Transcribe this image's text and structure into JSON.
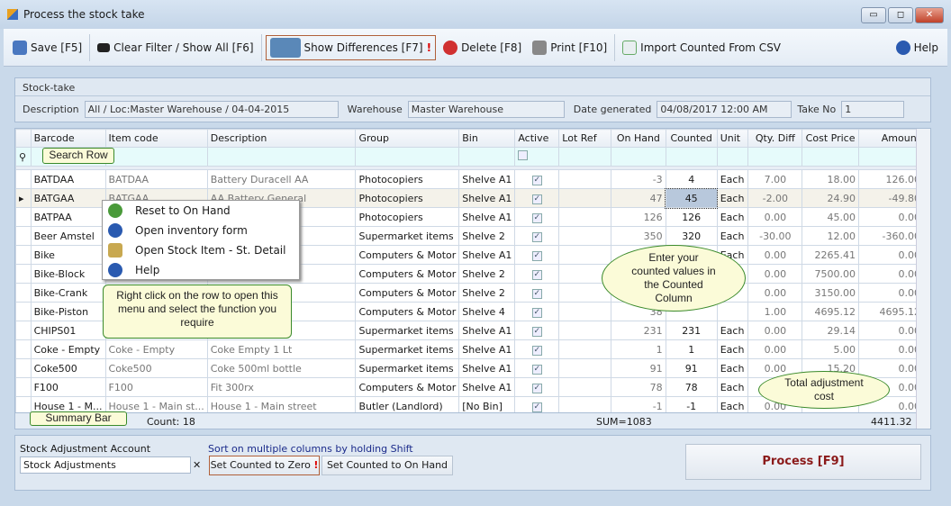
{
  "window": {
    "title": "Process the stock take",
    "minimize": "▭",
    "maximize": "◻",
    "close": "✕"
  },
  "toolbar": {
    "save": "Save [F5]",
    "clear": "Clear Filter / Show All [F6]",
    "diff": "Show Differences [F7]",
    "diff_mark": "!",
    "delete": "Delete [F8]",
    "print": "Print [F10]",
    "import": "Import Counted From CSV",
    "help": "Help"
  },
  "stocktake": {
    "header": "Stock-take",
    "desc_label": "Description",
    "desc": "All / Loc:Master Warehouse / 04-04-2015",
    "wh_label": "Warehouse",
    "wh": "Master Warehouse",
    "date_label": "Date generated",
    "date": "04/08/2017 12:00 AM",
    "take_label": "Take No",
    "take": "1"
  },
  "grid": {
    "columns": [
      "Barcode",
      "Item code",
      "Description",
      "Group",
      "Bin",
      "Active",
      "Lot Ref",
      "On Hand",
      "Counted",
      "Unit",
      "Qty. Diff",
      "Cost Price",
      "Amount"
    ],
    "rows": [
      [
        "BATDAA",
        "BATDAA",
        "Battery Duracell AA",
        "Photocopiers",
        "Shelve A1",
        "✓",
        "",
        "-3",
        "4",
        "Each",
        "7.00",
        "18.00",
        "126.00"
      ],
      [
        "BATGAA",
        "BATGAA",
        "AA Battery General",
        "Photocopiers",
        "Shelve A1",
        "✓",
        "",
        "47",
        "45",
        "Each",
        "-2.00",
        "24.90",
        "-49.80"
      ],
      [
        "BATPAA",
        "",
        "egression)",
        "Photocopiers",
        "Shelve A1",
        "✓",
        "",
        "126",
        "126",
        "Each",
        "0.00",
        "45.00",
        "0.00"
      ],
      [
        "Beer Amstel",
        "",
        "",
        "Supermarket items",
        "Shelve 2",
        "✓",
        "",
        "350",
        "320",
        "Each",
        "-30.00",
        "12.00",
        "-360.00"
      ],
      [
        "Bike",
        "",
        "",
        "Computers & Motor",
        "Shelve A1",
        "✓",
        "",
        "3",
        "",
        "Each",
        "0.00",
        "2265.41",
        "0.00"
      ],
      [
        "Bike-Block",
        "",
        "",
        "Computers & Motor",
        "Shelve 2",
        "✓",
        "",
        "",
        "",
        "",
        "0.00",
        "7500.00",
        "0.00"
      ],
      [
        "Bike-Crank",
        "",
        "",
        "Computers & Motor",
        "Shelve 2",
        "✓",
        "",
        "",
        "",
        "",
        "0.00",
        "3150.00",
        "0.00"
      ],
      [
        "Bike-Piston",
        "",
        "1",
        "Computers & Motor",
        "Shelve 4",
        "✓",
        "",
        "38",
        "",
        "",
        "1.00",
        "4695.12",
        "4695.12"
      ],
      [
        "CHIPS01",
        "",
        "n",
        "Supermarket items",
        "Shelve A1",
        "✓",
        "",
        "231",
        "231",
        "Each",
        "0.00",
        "29.14",
        "0.00"
      ],
      [
        "Coke - Empty",
        "Coke - Empty",
        "Coke Empty 1 Lt",
        "Supermarket items",
        "Shelve A1",
        "✓",
        "",
        "1",
        "1",
        "Each",
        "0.00",
        "5.00",
        "0.00"
      ],
      [
        "Coke500",
        "Coke500",
        "Coke 500ml bottle",
        "Supermarket items",
        "Shelve A1",
        "✓",
        "",
        "91",
        "91",
        "Each",
        "0.00",
        "15.20",
        "0.00"
      ],
      [
        "F100",
        "F100",
        "Fit 300rx",
        "Computers & Motor",
        "Shelve A1",
        "✓",
        "",
        "78",
        "78",
        "Each",
        "0.00",
        "",
        "0.00"
      ],
      [
        "House 1 - M...",
        "House 1 - Main st...",
        "House 1 - Main street",
        "Butler (Landlord)",
        "[No Bin]",
        "✓",
        "",
        "-1",
        "-1",
        "Each",
        "0.00",
        "",
        "0.00"
      ]
    ],
    "count": "Count: 18",
    "sum": "SUM=1083",
    "total": "4411.32"
  },
  "menu": [
    "Reset to On Hand",
    "Open inventory form",
    "Open Stock Item - St. Detail",
    "Help"
  ],
  "callouts": {
    "search": "Search Row",
    "summary": "Summary Bar",
    "rightclick": "Right click on the row to open this menu and select the function you require",
    "counted": "Enter your counted values in the Counted Column",
    "total": "Total adjustment cost"
  },
  "bottom": {
    "acct_label": "Stock Adjustment Account",
    "acct": "Stock Adjustments",
    "hint": "Sort on multiple columns by holding Shift",
    "zero": "Set Counted to Zero",
    "zero_mark": "!",
    "onhand": "Set Counted to On Hand",
    "process": "Process [F9]"
  },
  "colors": {
    "accent_border": "#b0603a",
    "process_text": "#8b1a1a",
    "callout_fill": "#fbfbd8",
    "callout_border": "#3a8a2a"
  }
}
